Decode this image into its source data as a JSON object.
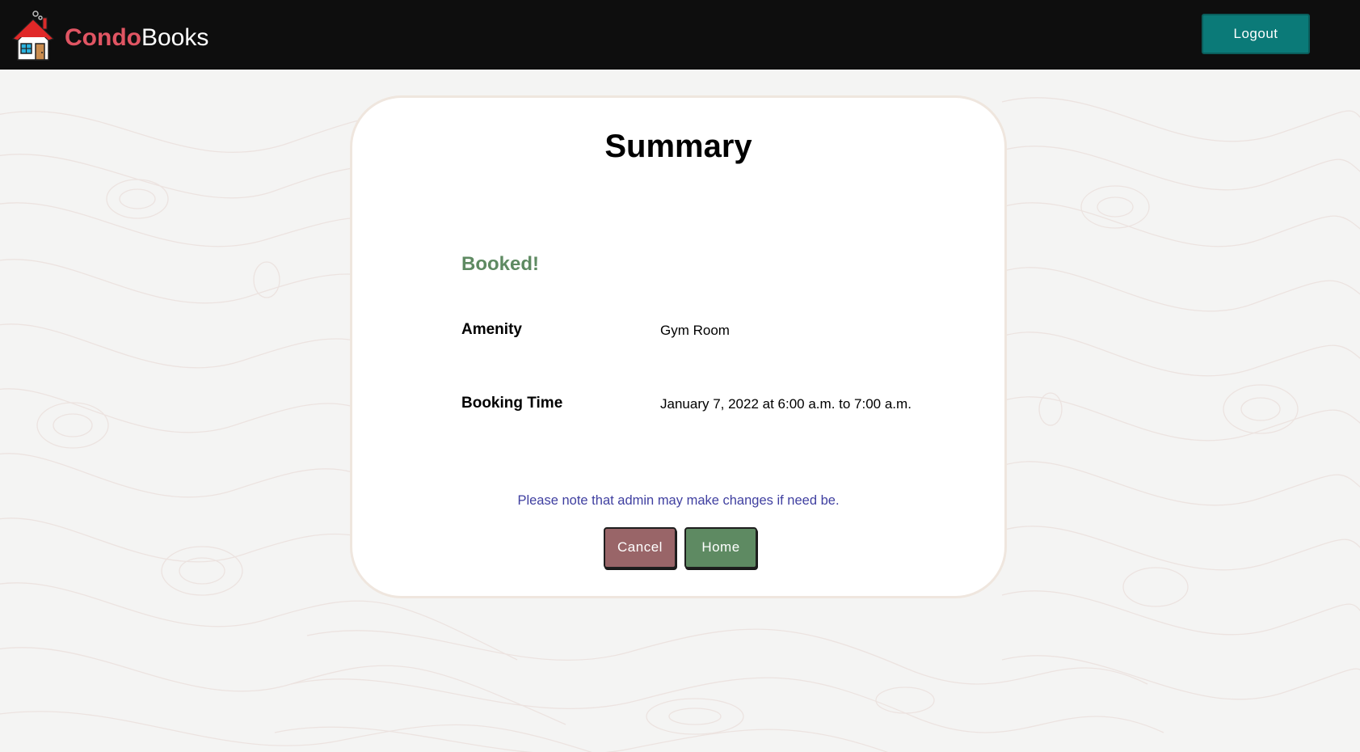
{
  "header": {
    "brand_part1": "Condo",
    "brand_part2": "Books",
    "logout_label": "Logout"
  },
  "summary": {
    "title": "Summary",
    "status": "Booked!",
    "rows": [
      {
        "label": "Amenity",
        "value": "Gym Room"
      },
      {
        "label": "Booking Time",
        "value": "January 7, 2022 at 6:00 a.m. to 7:00 a.m."
      }
    ],
    "note": "Please note that admin may make changes if need be.",
    "cancel_label": "Cancel",
    "home_label": "Home"
  },
  "colors": {
    "navbar": "#0e0e0e",
    "brand_accent": "#e05563",
    "logout": "#0b7a78",
    "booked": "#5e8a62",
    "cancel": "#996568",
    "home": "#5e8a62",
    "note": "#3f3fa0"
  },
  "icons": {
    "logo": "house-logo-icon"
  }
}
